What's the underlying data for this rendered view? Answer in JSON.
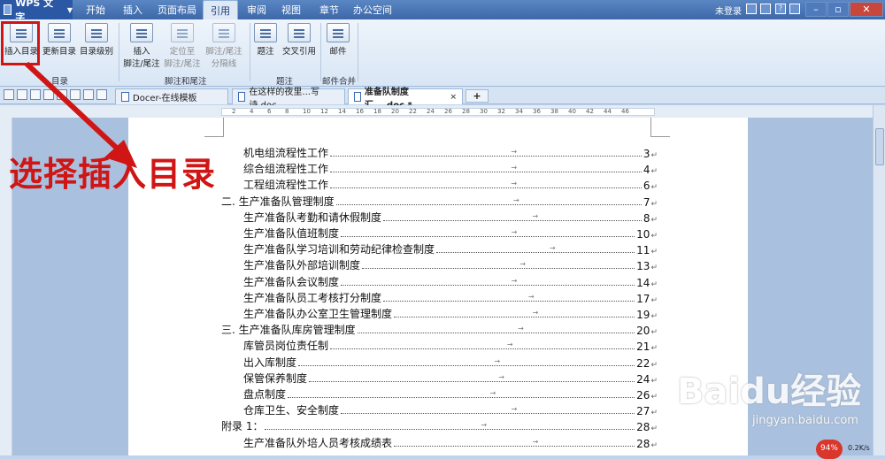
{
  "app": {
    "title": "WPS 文字"
  },
  "menu": {
    "tabs": [
      "开始",
      "插入",
      "页面布局",
      "引用",
      "审阅",
      "视图",
      "章节",
      "办公空间"
    ],
    "active": "引用"
  },
  "account": {
    "login": "未登录"
  },
  "ribbon": {
    "insert_toc": "插入目录",
    "update_toc": "更新目录",
    "toc_level": "目录级别",
    "insert_footnote": [
      "插入",
      "脚注/尾注"
    ],
    "locate_footnote": [
      "定位至",
      "脚注/尾注"
    ],
    "footnote_separator": [
      "脚注/尾注",
      "分隔线"
    ],
    "caption": "题注",
    "cross_ref": "交叉引用",
    "mail": "邮件",
    "group_toc": "目录",
    "group_footnote": "脚注和尾注",
    "group_caption": "题注",
    "group_mail": "邮件合并"
  },
  "tabs": [
    {
      "label": "Docer-在线模板"
    },
    {
      "label": "在这样的夜里...写诗.doc"
    },
    {
      "label": "准备队制度汇....doc *"
    }
  ],
  "ruler_numbers": [
    "2",
    "4",
    "6",
    "8",
    "10",
    "12",
    "14",
    "16",
    "18",
    "20",
    "22",
    "24",
    "26",
    "28",
    "30",
    "32",
    "34",
    "36",
    "38",
    "40",
    "42",
    "44",
    "46"
  ],
  "toc": [
    {
      "text": "机电组流程性工作",
      "page": "3",
      "indent": 1
    },
    {
      "text": "综合组流程性工作",
      "page": "4",
      "indent": 1
    },
    {
      "text": "工程组流程性工作",
      "page": "6",
      "indent": 1
    },
    {
      "text": "二. 生产准备队管理制度",
      "page": "7",
      "indent": 0
    },
    {
      "text": "生产准备队考勤和请休假制度",
      "page": "8",
      "indent": 1
    },
    {
      "text": "生产准备队值班制度",
      "page": "10",
      "indent": 1
    },
    {
      "text": "生产准备队学习培训和劳动纪律检查制度",
      "page": "11",
      "indent": 1
    },
    {
      "text": "生产准备队外部培训制度",
      "page": "13",
      "indent": 1
    },
    {
      "text": "生产准备队会议制度",
      "page": "14",
      "indent": 1
    },
    {
      "text": "生产准备队员工考核打分制度",
      "page": "17",
      "indent": 1
    },
    {
      "text": "生产准备队办公室卫生管理制度",
      "page": "19",
      "indent": 1
    },
    {
      "text": "三. 生产准备队库房管理制度",
      "page": "20",
      "indent": 0
    },
    {
      "text": "库管员岗位责任制",
      "page": "21",
      "indent": 1
    },
    {
      "text": "出入库制度",
      "page": "22",
      "indent": 1
    },
    {
      "text": "保管保养制度",
      "page": "24",
      "indent": 1
    },
    {
      "text": "盘点制度",
      "page": "26",
      "indent": 1
    },
    {
      "text": "仓库卫生、安全制度",
      "page": "27",
      "indent": 1
    },
    {
      "text": "附录 1：",
      "page": "28",
      "indent": 0
    },
    {
      "text": "生产准备队外培人员考核成绩表",
      "page": "28",
      "indent": 1
    }
  ],
  "annotation": {
    "text": "选择插入目录"
  },
  "watermark": {
    "main": "Baidu经验",
    "sub": "jingyan.baidu.com"
  },
  "status": {
    "badge": "94%",
    "speed": "0.2K/s"
  },
  "colors": {
    "annotation": "#d01515",
    "ribbon_bg": "#dfe9f6",
    "title_bar": "#3d68a8"
  }
}
